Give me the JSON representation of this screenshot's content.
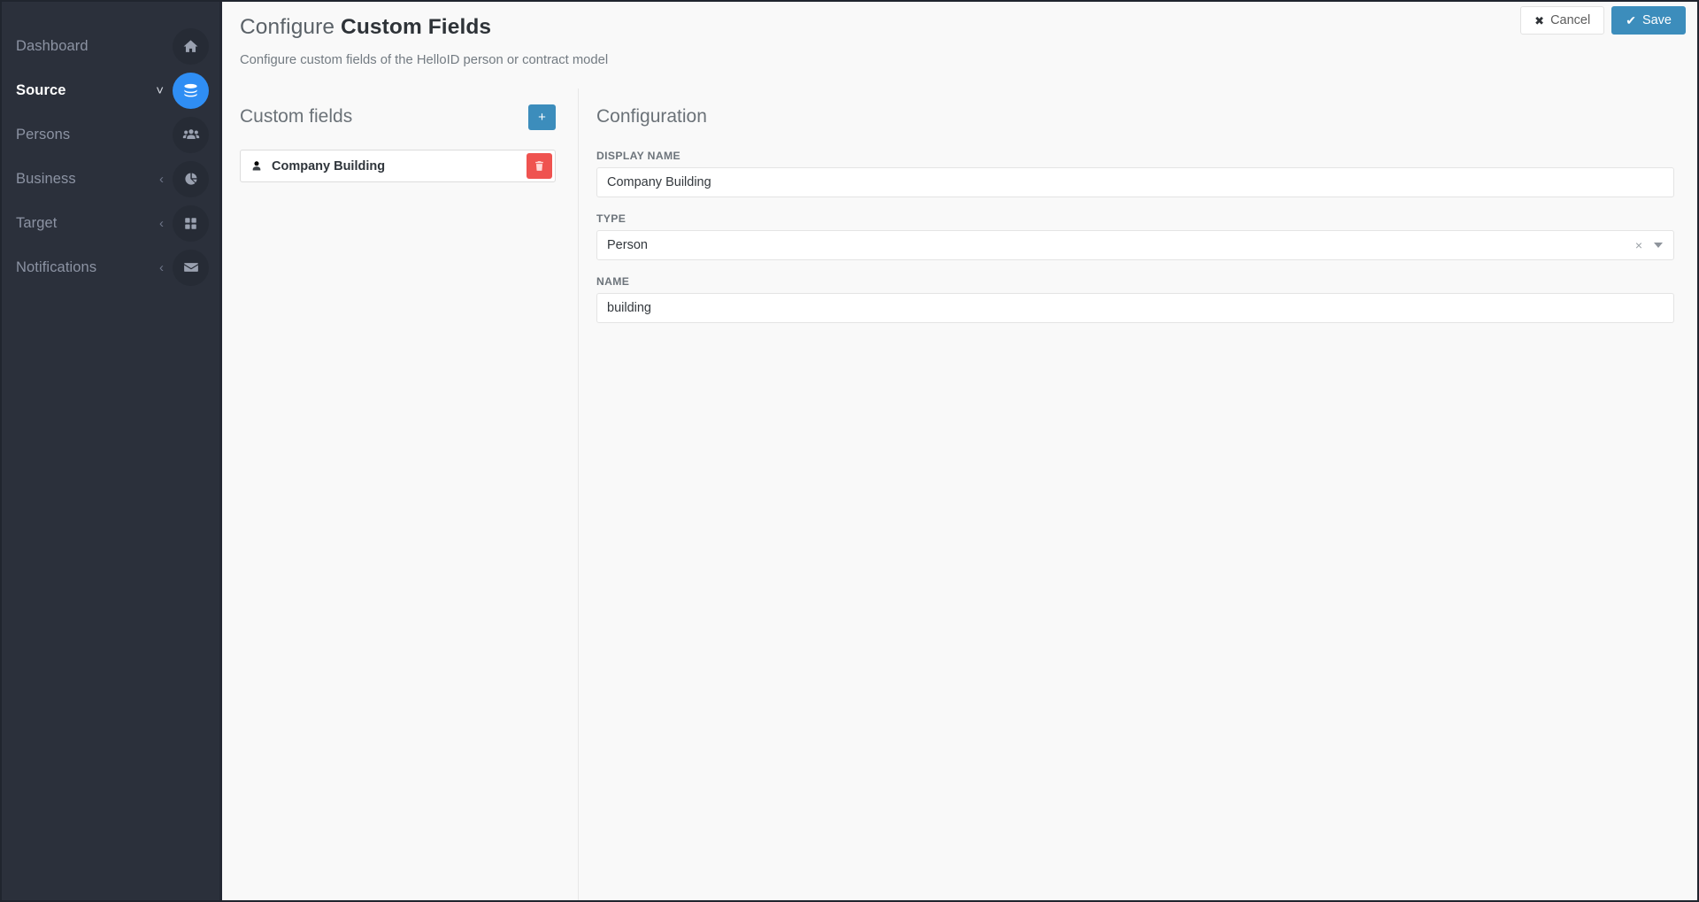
{
  "sidebar": {
    "items": [
      {
        "id": "dashboard",
        "label": "Dashboard",
        "icon": "home-icon",
        "chevron": "",
        "active": false
      },
      {
        "id": "source",
        "label": "Source",
        "icon": "database-icon",
        "chevron": "˅",
        "active": true
      },
      {
        "id": "persons",
        "label": "Persons",
        "icon": "users-icon",
        "chevron": "",
        "active": false
      },
      {
        "id": "business",
        "label": "Business",
        "icon": "chart-pie-icon",
        "chevron": "‹",
        "active": false
      },
      {
        "id": "target",
        "label": "Target",
        "icon": "grid-icon",
        "chevron": "‹",
        "active": false
      },
      {
        "id": "notifications",
        "label": "Notifications",
        "icon": "envelope-icon",
        "chevron": "‹",
        "active": false
      }
    ]
  },
  "header": {
    "title_prefix": "Configure ",
    "title_strong": "Custom Fields",
    "subtitle": "Configure custom fields of the HelloID person or contract model",
    "cancel_icon": "✖",
    "cancel_label": "Cancel",
    "save_icon": "✔",
    "save_label": "Save"
  },
  "custom_fields_panel": {
    "title": "Custom fields",
    "add_button_label": "+",
    "add_button_icon": "plus-icon",
    "items": [
      {
        "label": "Company Building",
        "icon": "person-icon",
        "delete_icon": "trash-icon"
      }
    ]
  },
  "configuration_panel": {
    "title": "Configuration",
    "fields": {
      "display_name": {
        "label": "DISPLAY NAME",
        "value": "Company Building",
        "placeholder": ""
      },
      "type": {
        "label": "TYPE",
        "value": "Person",
        "placeholder": "",
        "clear_icon": "×",
        "caret_icon": "chevron-down-icon"
      },
      "name": {
        "label": "NAME",
        "value": "building",
        "placeholder": ""
      }
    }
  },
  "colors": {
    "sidebar_bg": "#2b303b",
    "accent_blue": "#3c8dbc",
    "active_blue": "#2f8ef4",
    "danger_red": "#ef5350"
  }
}
